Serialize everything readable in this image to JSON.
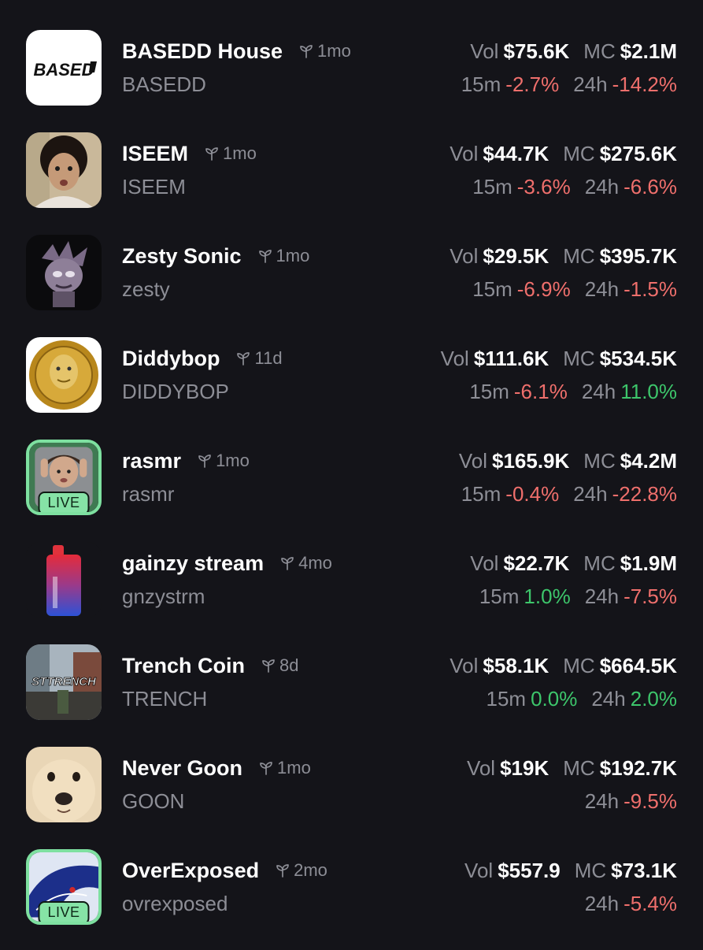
{
  "colors": {
    "background": "#141419",
    "negative": "#ef6f6c",
    "positive": "#3dc66b",
    "muted": "#8d8e96",
    "live_badge": "#86e3a6"
  },
  "labels": {
    "vol": "Vol",
    "mc": "MC",
    "change_15m": "15m",
    "change_24h": "24h",
    "live": "LIVE"
  },
  "tokens": [
    {
      "name": "BASEDD House",
      "age": "1mo",
      "ticker": "BASEDD",
      "vol": "$75.6K",
      "mc": "$2.1M",
      "change_15m": "-2.7%",
      "change_24h": "-14.2%",
      "live": false,
      "avatar_icon": "based-logo-icon",
      "avatar_text": "BASED"
    },
    {
      "name": "ISEEM",
      "age": "1mo",
      "ticker": "ISEEM",
      "vol": "$44.7K",
      "mc": "$275.6K",
      "change_15m": "-3.6%",
      "change_24h": "-6.6%",
      "live": false,
      "avatar_icon": "person-photo-icon"
    },
    {
      "name": "Zesty Sonic",
      "age": "1mo",
      "ticker": "zesty",
      "vol": "$29.5K",
      "mc": "$395.7K",
      "change_15m": "-6.9%",
      "change_24h": "-1.5%",
      "live": false,
      "avatar_icon": "sonic-character-icon"
    },
    {
      "name": "Diddybop",
      "age": "11d",
      "ticker": "DIDDYBOP",
      "vol": "$111.6K",
      "mc": "$534.5K",
      "change_15m": "-6.1%",
      "change_24h": "11.0%",
      "live": false,
      "avatar_icon": "gold-coin-icon"
    },
    {
      "name": "rasmr",
      "age": "1mo",
      "ticker": "rasmr",
      "vol": "$165.9K",
      "mc": "$4.2M",
      "change_15m": "-0.4%",
      "change_24h": "-22.8%",
      "live": true,
      "avatar_icon": "streamer-photo-icon"
    },
    {
      "name": "gainzy stream",
      "age": "4mo",
      "ticker": "gnzystrm",
      "vol": "$22.7K",
      "mc": "$1.9M",
      "change_15m": "1.0%",
      "change_24h": "-7.5%",
      "live": false,
      "avatar_icon": "vape-device-icon"
    },
    {
      "name": "Trench Coin",
      "age": "8d",
      "ticker": "TRENCH",
      "vol": "$58.1K",
      "mc": "$664.5K",
      "change_15m": "0.0%",
      "change_24h": "2.0%",
      "live": false,
      "avatar_icon": "street-scene-icon"
    },
    {
      "name": "Never Goon",
      "age": "1mo",
      "ticker": "GOON",
      "vol": "$19K",
      "mc": "$192.7K",
      "change_15m": null,
      "change_24h": "-9.5%",
      "live": false,
      "avatar_icon": "dog-photo-icon"
    },
    {
      "name": "OverExposed",
      "age": "2mo",
      "ticker": "ovrexposed",
      "vol": "$557.9",
      "mc": "$73.1K",
      "change_15m": null,
      "change_24h": "-5.4%",
      "live": true,
      "avatar_icon": "blue-abstract-icon"
    }
  ]
}
